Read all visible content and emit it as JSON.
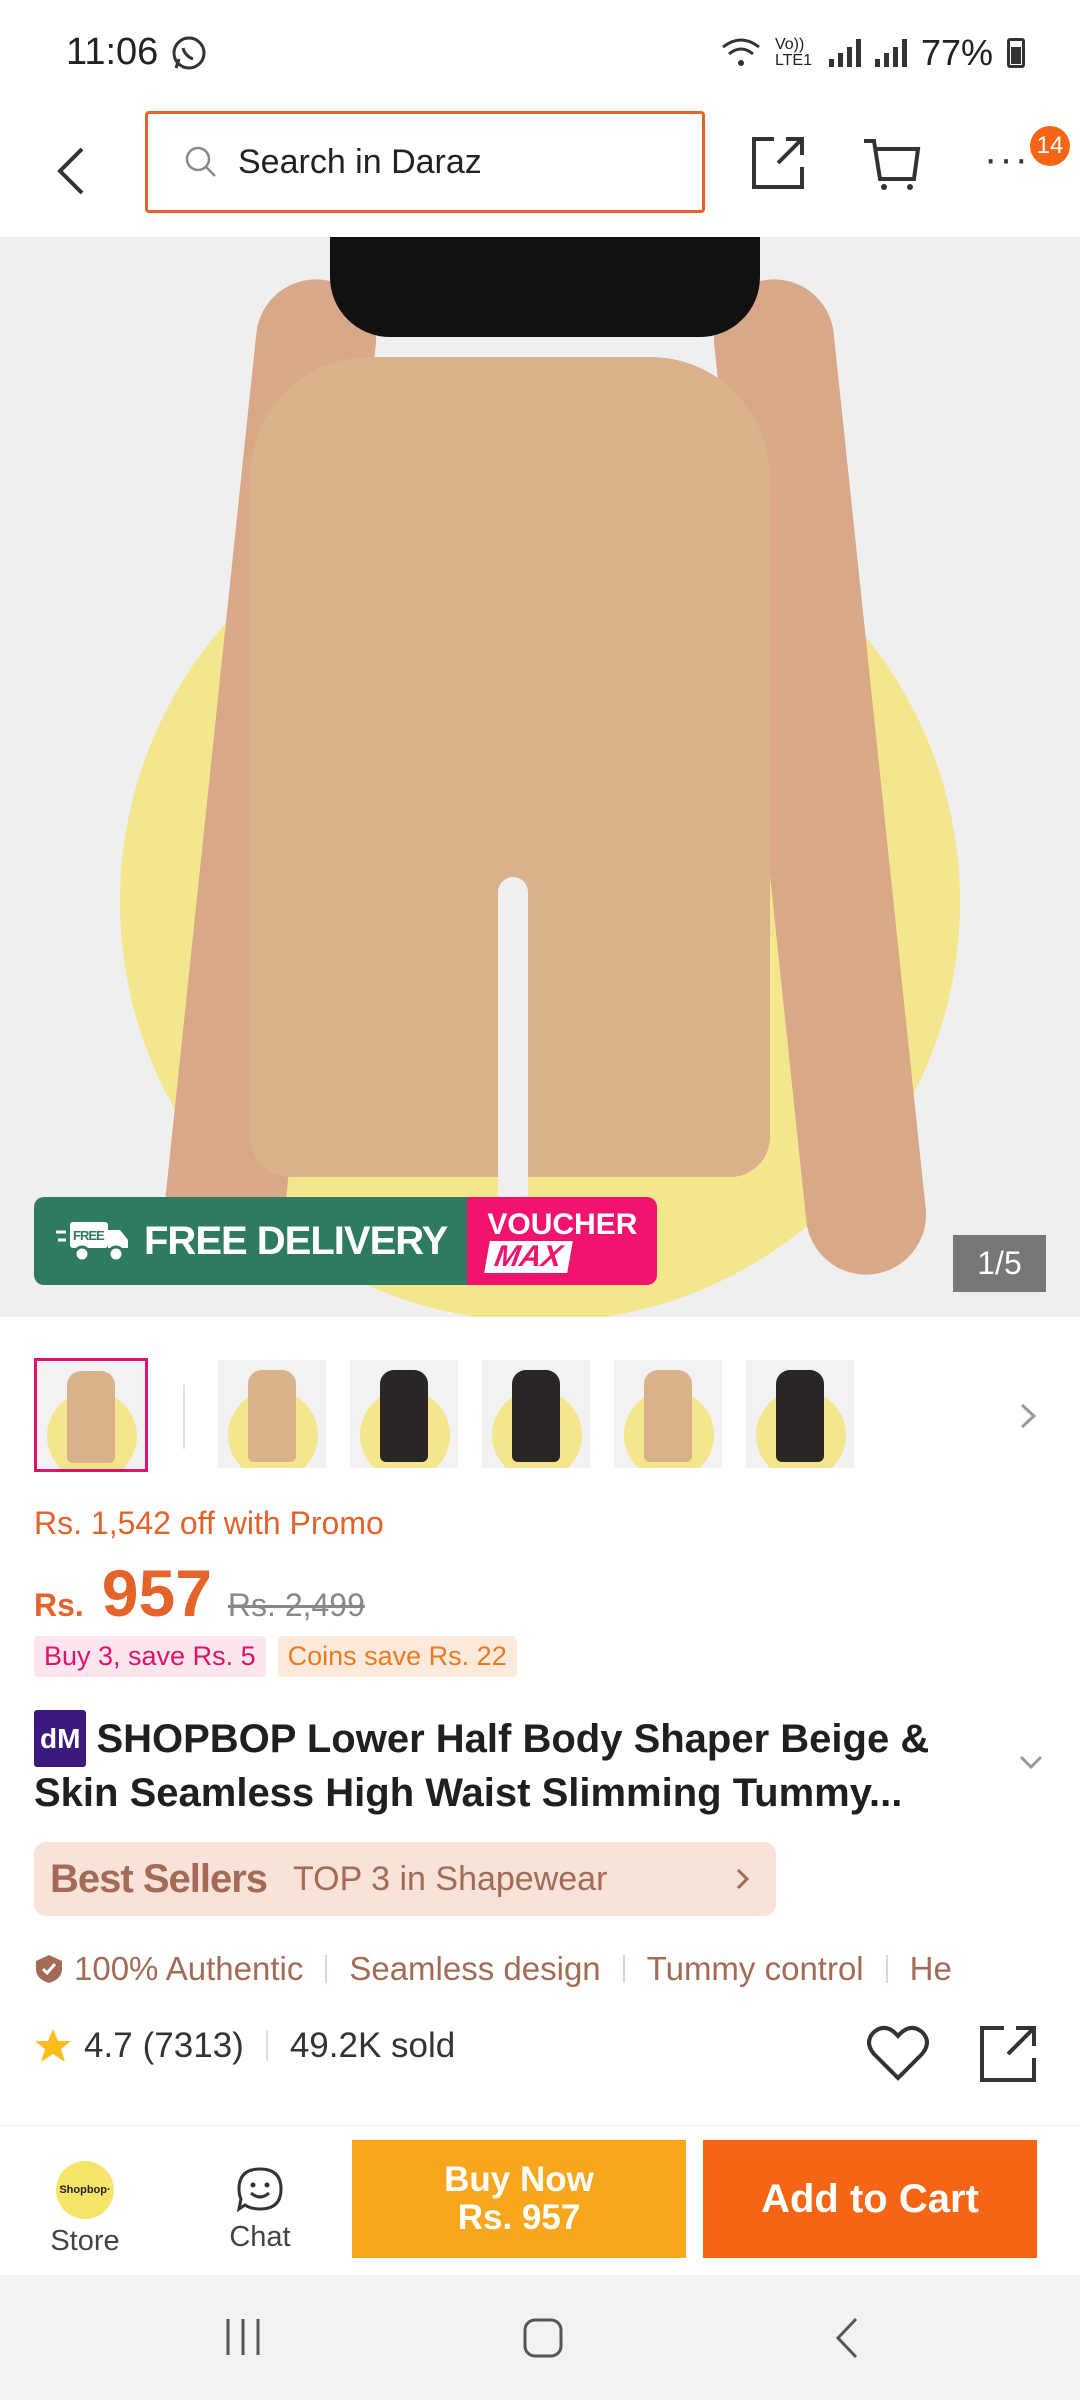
{
  "status_bar": {
    "time": "11:06",
    "network": "Vo)) LTE1",
    "battery": "77%"
  },
  "top_bar": {
    "search_placeholder": "Search in Daraz",
    "more_badge": "14"
  },
  "gallery": {
    "promo_delivery": "FREE DELIVERY",
    "promo_truck_label": "FREE",
    "promo_voucher_line1": "VOUCHER",
    "promo_voucher_line2": "MAX",
    "counter": "1/5",
    "thumbnail_colors": [
      "#d9b18b",
      "#d9b18b",
      "#2a2626",
      "#2a2626",
      "#d9b18b",
      "#2a2626"
    ]
  },
  "price": {
    "promo_text": "Rs. 1,542 off with Promo",
    "currency": "Rs.",
    "current": "957",
    "original": "Rs. 2,499",
    "tags": [
      "Buy 3, save Rs. 5",
      "Coins save Rs. 22"
    ]
  },
  "product": {
    "brand_badge": "dM",
    "title": "SHOPBOP Lower Half Body Shaper Beige & Skin Seamless High Waist Slimming Tummy..."
  },
  "best_sellers": {
    "label": "Best Sellers",
    "text": "TOP 3 in Shapewear"
  },
  "highlights": [
    "100% Authentic",
    "Seamless design",
    "Tummy control",
    "He"
  ],
  "rating": {
    "score": "4.7",
    "count": "(7313)",
    "sold": "49.2K sold"
  },
  "action_bar": {
    "store_label": "Store",
    "store_logo_text": "Shopbop·",
    "chat_label": "Chat",
    "buy_now_line1": "Buy Now",
    "buy_now_line2": "Rs. 957",
    "add_to_cart": "Add to Cart"
  },
  "colors": {
    "accent": "#f56514",
    "buy_now": "#f8a61e",
    "search_border": "#e5622a",
    "delivery_green": "#2f7a62",
    "voucher_pink": "#f1146f"
  }
}
